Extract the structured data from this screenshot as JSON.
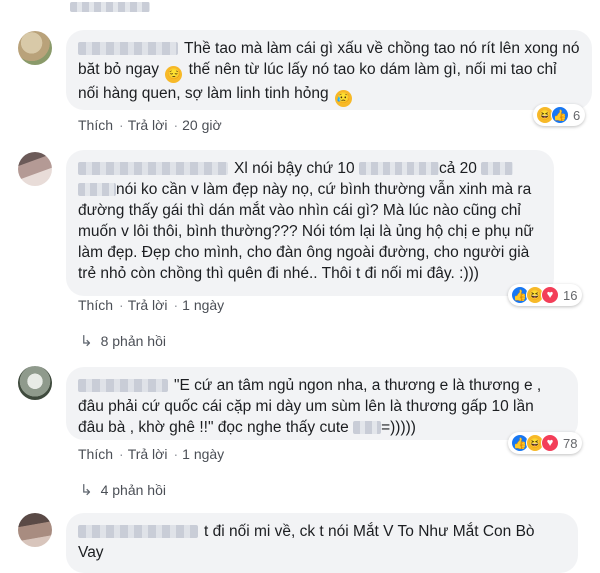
{
  "comments": [
    {
      "text": "Thề tao mà làm cái gì xấu về chồng tao nó rít lên xong nó băt bỏ ngay",
      "emoji1": "😔",
      "text2": " thế nên từ lúc lấy nó tao ko dám làm gì, nối mi tao chỉ nối hàng quen, sợ làm linh tinh hỏng",
      "emoji2": "😥",
      "like": "Thích",
      "reply": "Trả lời",
      "time": "20 giờ",
      "reactions": "6"
    },
    {
      "line1_a": "Xl nói bậy chứ 10",
      "line1_b": "cả 20",
      "line2": "nói ko cần v làm đẹp này nọ, cứ bình thường vẫn xinh mà ra",
      "line3": "đường thấy gái thì dán mắt vào nhìn cái gì? Mà lúc nào cũng chỉ",
      "line4": "muốn v lôi thôi, bình thường??? Nói tóm lại là ủng hộ chị e phụ nữ",
      "line5": "làm đẹp. Đẹp cho mình, cho đàn ông ngoài đường, cho người già",
      "line6": "trẻ nhỏ còn chồng thì quên đi nhé.. Thôi t đi nối mi đây. :)))",
      "like": "Thích",
      "reply": "Trả lời",
      "time": "1 ngày",
      "reactions": "16",
      "replies": "8 phản hồi"
    },
    {
      "line1": "\"E cứ an tâm ngủ ngon nha, a thương e là thương e ,",
      "line2": "đâu phải cứ quốc cái cặp mi dày um sùm lên là thương gấp 10 lần",
      "line3_a": "đâu bà , khờ ghê !!\" đọc nghe thấy cute",
      "line3_b": "=)))))",
      "like": "Thích",
      "reply": "Trả lời",
      "time": "1 ngày",
      "reactions": "78",
      "replies": "4 phản hồi"
    },
    {
      "line1": "t đi nối mi về, ck t nói Mắt V To Như Mắt Con Bò",
      "line2": "Vay"
    }
  ]
}
